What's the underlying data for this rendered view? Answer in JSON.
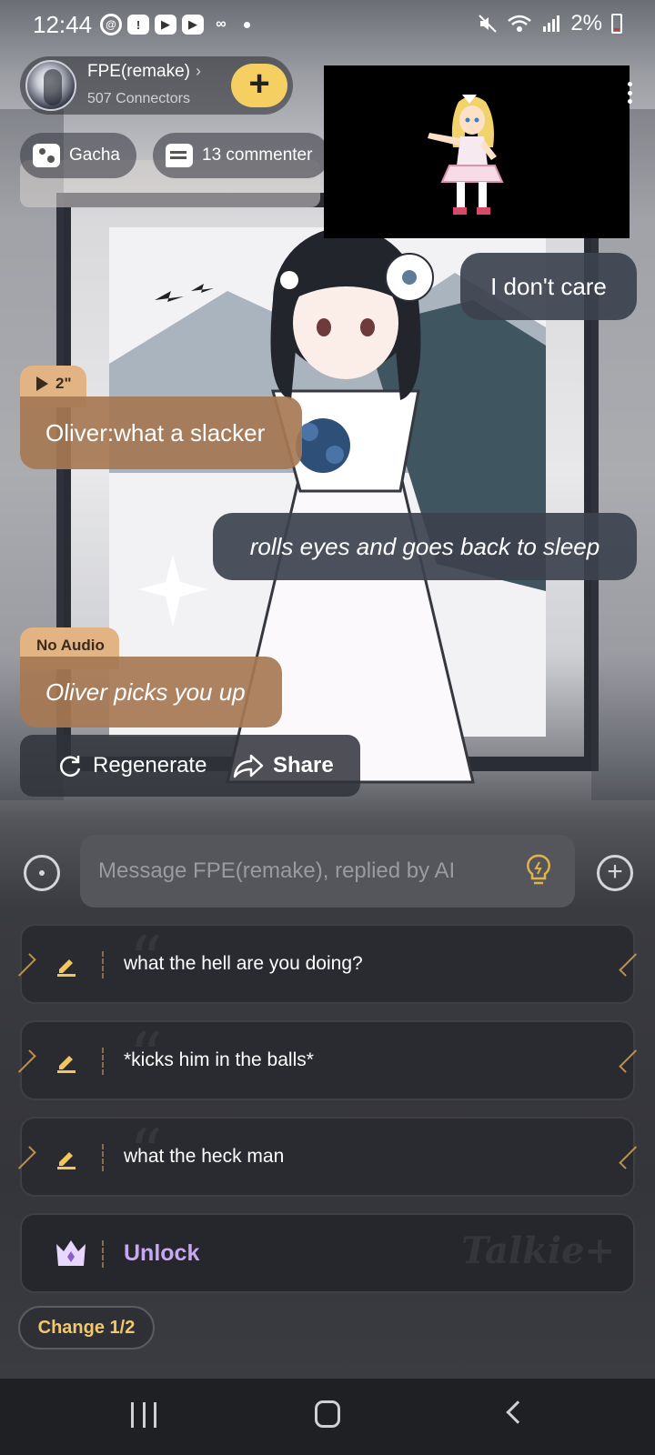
{
  "status_bar": {
    "time": "12:44",
    "battery": "2%",
    "notification_icons": [
      "threads-icon",
      "alert-icon",
      "youtube-icon",
      "youtube-icon",
      "voicemail-icon",
      "dot-icon"
    ],
    "system_icons": [
      "mute-icon",
      "wifi-icon",
      "signal-icon",
      "battery-icon"
    ]
  },
  "header": {
    "character_name": "FPE(remake)",
    "connectors": "507 Connectors",
    "follow_symbol": "+"
  },
  "chips": {
    "gacha": "Gacha",
    "comments": "13 commenter"
  },
  "messages": [
    {
      "role": "user",
      "text": "I don't care"
    },
    {
      "role": "ai",
      "audio": "2\"",
      "text": "Oliver:what a slacker"
    },
    {
      "role": "user",
      "text": "rolls eyes and goes back to sleep"
    },
    {
      "role": "ai",
      "audio": "No Audio",
      "text": "Oliver picks you up"
    }
  ],
  "actions": {
    "regenerate": "Regenerate",
    "share": "Share"
  },
  "composer": {
    "placeholder": "Message FPE(remake), replied by AI"
  },
  "suggestions": [
    "what the hell are you doing?",
    "*kicks him in the balls*",
    "what the heck man"
  ],
  "unlock": {
    "label": "Unlock",
    "watermark": "Talkie+"
  },
  "change": "Change 1/2",
  "colors": {
    "accent_yellow": "#f5cf61",
    "ai_bubble": "#a67854",
    "user_bubble": "#3c424e",
    "unlock_purple": "#c8a8f0"
  }
}
